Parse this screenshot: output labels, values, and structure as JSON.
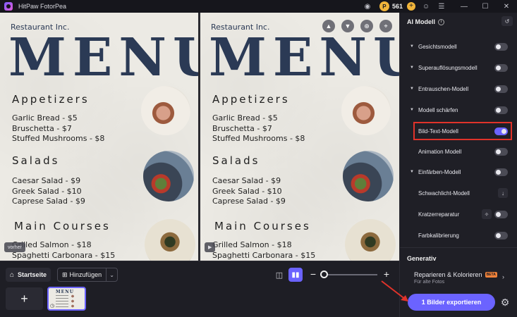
{
  "app": {
    "title": "HitPaw FotorPea",
    "credits": "561"
  },
  "canvas": {
    "menu": {
      "company": "Restaurant Inc.",
      "title": "MENU",
      "sections": [
        {
          "title": "Appetizers",
          "items": [
            "Garlic Bread - $5",
            "Bruschetta - $7",
            "Stuffed Mushrooms - $8"
          ]
        },
        {
          "title": "Salads",
          "items": [
            "Caesar Salad - $9",
            "Greek Salad - $10",
            "Caprese Salad - $9"
          ]
        },
        {
          "title": "Main Courses",
          "items": [
            "Grilled Salmon - $18",
            "Spaghetti Carbonara - $15"
          ]
        }
      ]
    },
    "left_tag": "vorher",
    "right_icons": [
      "thumbs-up-icon",
      "thumbs-down-icon",
      "zoom-icon",
      "crop-icon"
    ]
  },
  "bottom": {
    "home_label": "Startseite",
    "add_label": "Hinzufügen",
    "add_tile": "+"
  },
  "ai_panel": {
    "header": "AI Modell",
    "options": [
      {
        "label": "Gesichtsmodell",
        "expandable": true,
        "on": false
      },
      {
        "label": "Superauflösungsmodell",
        "expandable": true,
        "on": false
      },
      {
        "label": "Entrauschen-Modell",
        "expandable": true,
        "on": false
      },
      {
        "label": "Modell schärfen",
        "expandable": true,
        "on": false
      },
      {
        "label": "Bild-Text-Modell",
        "expandable": false,
        "on": true
      },
      {
        "label": "Animation Modell",
        "expandable": false,
        "on": false
      },
      {
        "label": "Einfärben-Modell",
        "expandable": true,
        "on": false
      },
      {
        "label": "Schwachlicht-Modell",
        "expandable": false,
        "control": "download"
      },
      {
        "label": "Kratzerreparatur",
        "expandable": false,
        "on": false
      },
      {
        "label": "Farbkalibrierung",
        "expandable": false,
        "on": false
      }
    ],
    "generative": {
      "header": "Generativ",
      "repair_label": "Reparieren & Kolorieren",
      "beta": "BETA",
      "repair_sub": "Für alte Fotos"
    },
    "export_label": "1 Bilder exportieren"
  },
  "colors": {
    "accent": "#6b63ff",
    "highlight": "#e0332a",
    "coin": "#f2b53a"
  }
}
